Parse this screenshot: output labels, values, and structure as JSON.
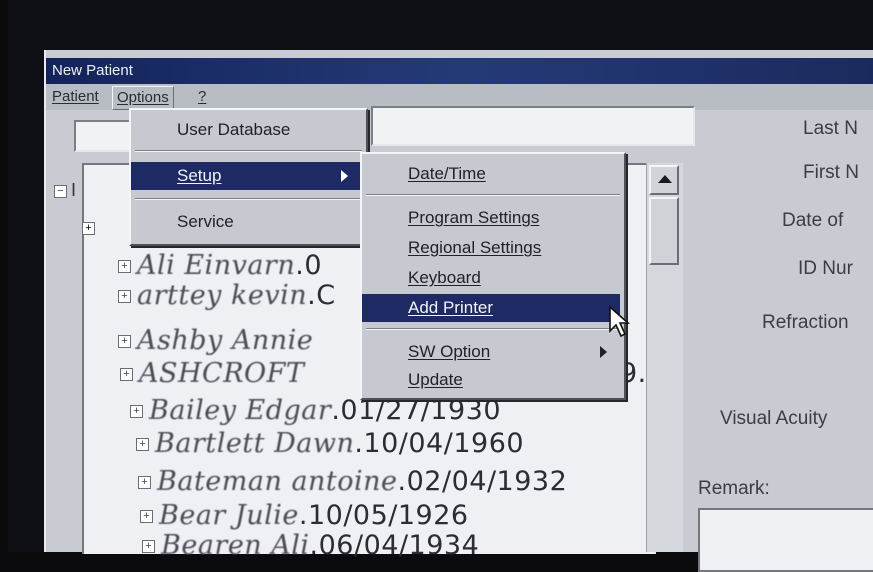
{
  "window": {
    "title": "New Patient"
  },
  "menubar": {
    "patient": "Patient",
    "options": "Options",
    "help": "?"
  },
  "options_menu": {
    "items": [
      {
        "label": "User Database"
      },
      {
        "label": "Setup"
      },
      {
        "label": "Service"
      }
    ]
  },
  "setup_menu": {
    "items": [
      {
        "label": "Date/Time"
      },
      {
        "label": "Program Settings"
      },
      {
        "label": "Regional Settings"
      },
      {
        "label": "Keyboard"
      },
      {
        "label": "Add Printer"
      },
      {
        "label": "SW Option"
      },
      {
        "label": "Update"
      }
    ]
  },
  "tree": {
    "root_prefix": "I",
    "rows": [
      {
        "name": "Ali Einvarn",
        "date": ".0"
      },
      {
        "name": "arttey kevin",
        "date": ".C"
      },
      {
        "name": "Ashby Annie",
        "date": ""
      },
      {
        "name": "ASHCROFT",
        "date": "9."
      },
      {
        "name": "Bailey Edgar",
        "date": ".01/27/1930"
      },
      {
        "name": "Bartlett Dawn",
        "date": ".10/04/1960"
      },
      {
        "name": "Bateman antoine",
        "date": ".02/04/1932"
      },
      {
        "name": "Bear Julie",
        "date": ".10/05/1926"
      },
      {
        "name": "Bearen Ali",
        "date": ".06/04/1934"
      }
    ]
  },
  "form_labels": {
    "last_name": "Last N",
    "first_name": "First N",
    "date_of": "Date of",
    "id_num": "ID Nur",
    "refraction": "Refraction",
    "visual_acuity": "Visual Acuity",
    "remark": "Remark:"
  }
}
